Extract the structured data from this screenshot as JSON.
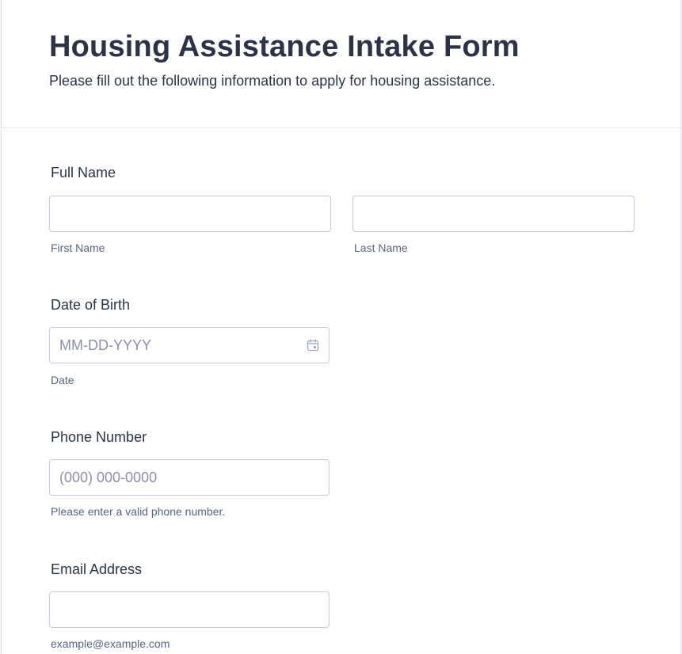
{
  "header": {
    "title": "Housing Assistance Intake Form",
    "subtitle": "Please fill out the following information to apply for housing assistance."
  },
  "fields": {
    "full_name": {
      "label": "Full Name",
      "first": {
        "value": "",
        "placeholder": "",
        "sublabel": "First Name"
      },
      "last": {
        "value": "",
        "placeholder": "",
        "sublabel": "Last Name"
      }
    },
    "date_of_birth": {
      "label": "Date of Birth",
      "value": "",
      "placeholder": "MM-DD-YYYY",
      "sublabel": "Date",
      "icon": "calendar-icon"
    },
    "phone": {
      "label": "Phone Number",
      "value": "",
      "placeholder": "(000) 000-0000",
      "sublabel": "Please enter a valid phone number."
    },
    "email": {
      "label": "Email Address",
      "value": "",
      "placeholder": "",
      "sublabel": "example@example.com"
    }
  },
  "colors": {
    "text": "#2c3345",
    "sublabel": "#57647e",
    "placeholder": "#8d8fa8",
    "input_border": "#c3cad8",
    "divider": "#e6e7ec"
  }
}
